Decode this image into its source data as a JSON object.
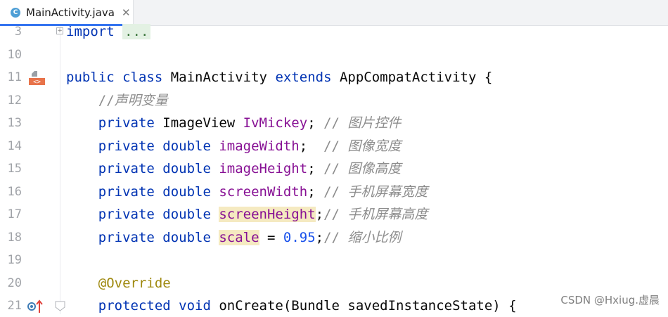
{
  "tab": {
    "icon_letter": "C",
    "filename": "MainActivity.java",
    "close": "✕"
  },
  "lines": [
    {
      "num": "3",
      "parts": [
        [
          "kw",
          "import"
        ],
        [
          "",
          " "
        ],
        [
          "fold",
          "..."
        ]
      ]
    },
    {
      "num": "10",
      "parts": []
    },
    {
      "num": "11",
      "parts": [
        [
          "kw",
          "public class "
        ],
        [
          "",
          "MainActivity "
        ],
        [
          "kw",
          "extends "
        ],
        [
          "",
          "AppCompatActivity {"
        ]
      ]
    },
    {
      "num": "12",
      "parts": [
        [
          "",
          "    "
        ],
        [
          "cmt-s",
          "//"
        ],
        [
          "cmt",
          "声明变量"
        ]
      ]
    },
    {
      "num": "13",
      "parts": [
        [
          "",
          "    "
        ],
        [
          "kw",
          "private "
        ],
        [
          "",
          "ImageView "
        ],
        [
          "fld",
          "IvMickey"
        ],
        [
          "",
          "; "
        ],
        [
          "cmt-s",
          "// "
        ],
        [
          "cmt",
          "图片控件"
        ]
      ]
    },
    {
      "num": "14",
      "parts": [
        [
          "",
          "    "
        ],
        [
          "kw",
          "private double "
        ],
        [
          "fld",
          "imageWidth"
        ],
        [
          "",
          ";  "
        ],
        [
          "cmt-s",
          "// "
        ],
        [
          "cmt",
          "图像宽度"
        ]
      ]
    },
    {
      "num": "15",
      "parts": [
        [
          "",
          "    "
        ],
        [
          "kw",
          "private double "
        ],
        [
          "fld",
          "imageHeight"
        ],
        [
          "",
          "; "
        ],
        [
          "cmt-s",
          "// "
        ],
        [
          "cmt",
          "图像高度"
        ]
      ]
    },
    {
      "num": "16",
      "parts": [
        [
          "",
          "    "
        ],
        [
          "kw",
          "private double "
        ],
        [
          "fld",
          "screenWidth"
        ],
        [
          "",
          "; "
        ],
        [
          "cmt-s",
          "// "
        ],
        [
          "cmt",
          "手机屏幕宽度"
        ]
      ]
    },
    {
      "num": "17",
      "parts": [
        [
          "",
          "    "
        ],
        [
          "kw",
          "private double "
        ],
        [
          "fld hl",
          "screenHeight"
        ],
        [
          "",
          ";"
        ],
        [
          "cmt-s",
          "// "
        ],
        [
          "cmt",
          "手机屏幕高度"
        ]
      ]
    },
    {
      "num": "18",
      "parts": [
        [
          "",
          "    "
        ],
        [
          "kw",
          "private double "
        ],
        [
          "fld hl",
          "scale"
        ],
        [
          "",
          " = "
        ],
        [
          "num",
          "0.95"
        ],
        [
          "",
          ";"
        ],
        [
          "cmt-s",
          "// "
        ],
        [
          "cmt",
          "缩小比例"
        ]
      ]
    },
    {
      "num": "19",
      "parts": []
    },
    {
      "num": "20",
      "parts": [
        [
          "",
          "    "
        ],
        [
          "ann",
          "@Override"
        ]
      ]
    },
    {
      "num": "21",
      "parts": [
        [
          "",
          "    "
        ],
        [
          "kw",
          "protected void "
        ],
        [
          "",
          "onCreate(Bundle savedInstanceState) {"
        ]
      ]
    }
  ],
  "gutter_icons": {
    "line11": "implemented-activity-icon",
    "line21": "override-method-icon"
  },
  "watermark": "CSDN @Hxiug.虚晨"
}
